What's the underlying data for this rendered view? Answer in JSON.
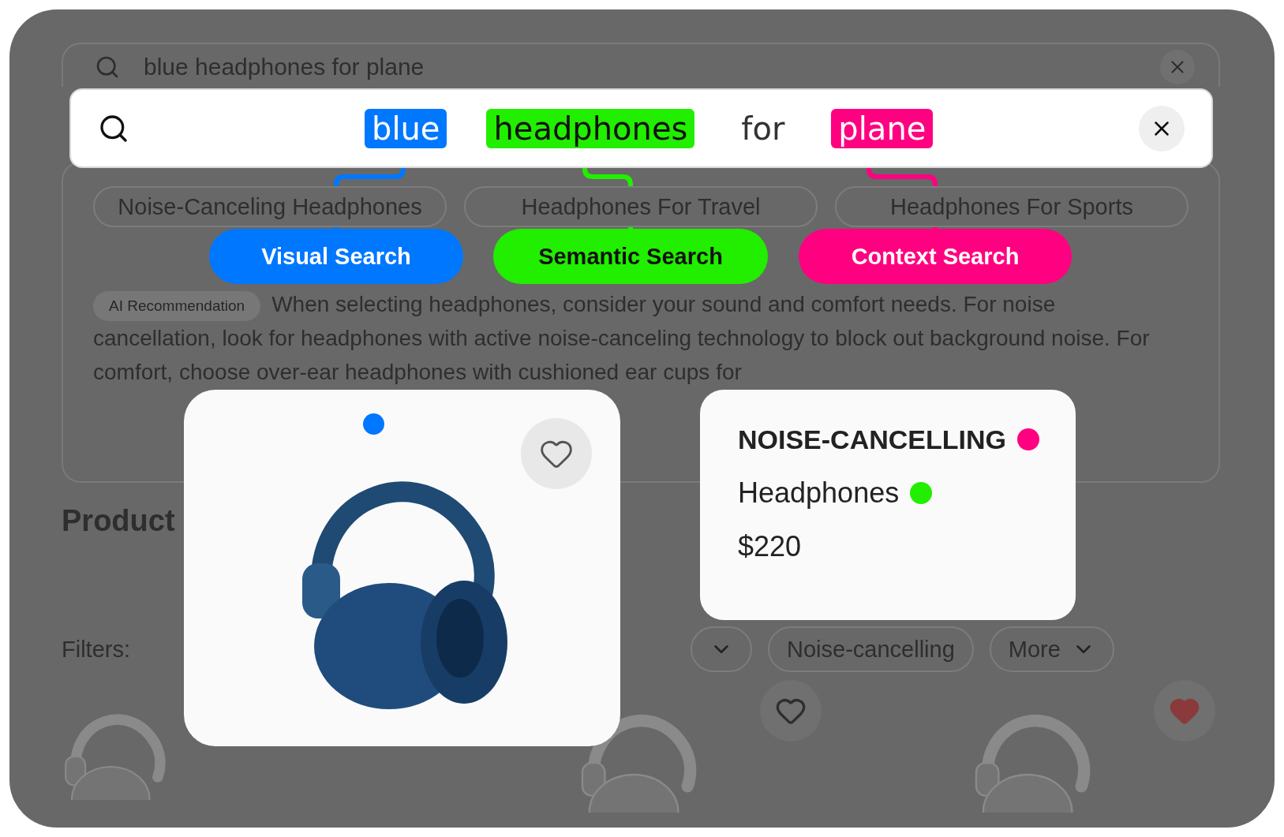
{
  "background_page": {
    "search": {
      "value": "blue headphones for plane"
    },
    "suggestions": [
      {
        "label": "Noise-Canceling Headphones"
      },
      {
        "label": "Headphones For Travel"
      },
      {
        "label": "Headphones For Sports"
      }
    ],
    "ai_badge": "AI Recommendation",
    "recommendation": "When selecting headphones, consider your sound and comfort needs. For noise cancellation, look for headphones with active noise-canceling technology to block out background noise. For comfort, choose over-ear headphones with cushioned ear cups for",
    "section_title": "Product",
    "filters_label": "Filters:",
    "filters": [
      {
        "kind": "dropdown"
      },
      {
        "label": "Noise-cancelling",
        "kind": "plain"
      },
      {
        "label": "More",
        "kind": "dropdown"
      }
    ],
    "products": [
      {
        "kind": "plain"
      },
      {
        "kind": "favorite",
        "liked": false
      },
      {
        "kind": "favorite",
        "liked": true
      }
    ]
  },
  "query": {
    "tokens": [
      {
        "text": "blue",
        "kind": "visual"
      },
      {
        "text": "headphones",
        "kind": "semantic"
      },
      {
        "text": "for",
        "kind": "plain"
      },
      {
        "text": "plane",
        "kind": "context"
      }
    ]
  },
  "search_modes": [
    {
      "label": "Visual Search",
      "kind": "visual"
    },
    {
      "label": "Semantic Search",
      "kind": "semantic"
    },
    {
      "label": "Context Search",
      "kind": "context"
    }
  ],
  "product_card": {
    "liked": false,
    "tag_dot": {
      "color": "#0077ff"
    }
  },
  "info_card": {
    "lines": [
      {
        "text": "NOISE-CANCELLING",
        "kind": "context"
      },
      {
        "text": "Headphones",
        "kind": "semantic"
      },
      {
        "text": "$220",
        "kind": "plain"
      }
    ]
  }
}
